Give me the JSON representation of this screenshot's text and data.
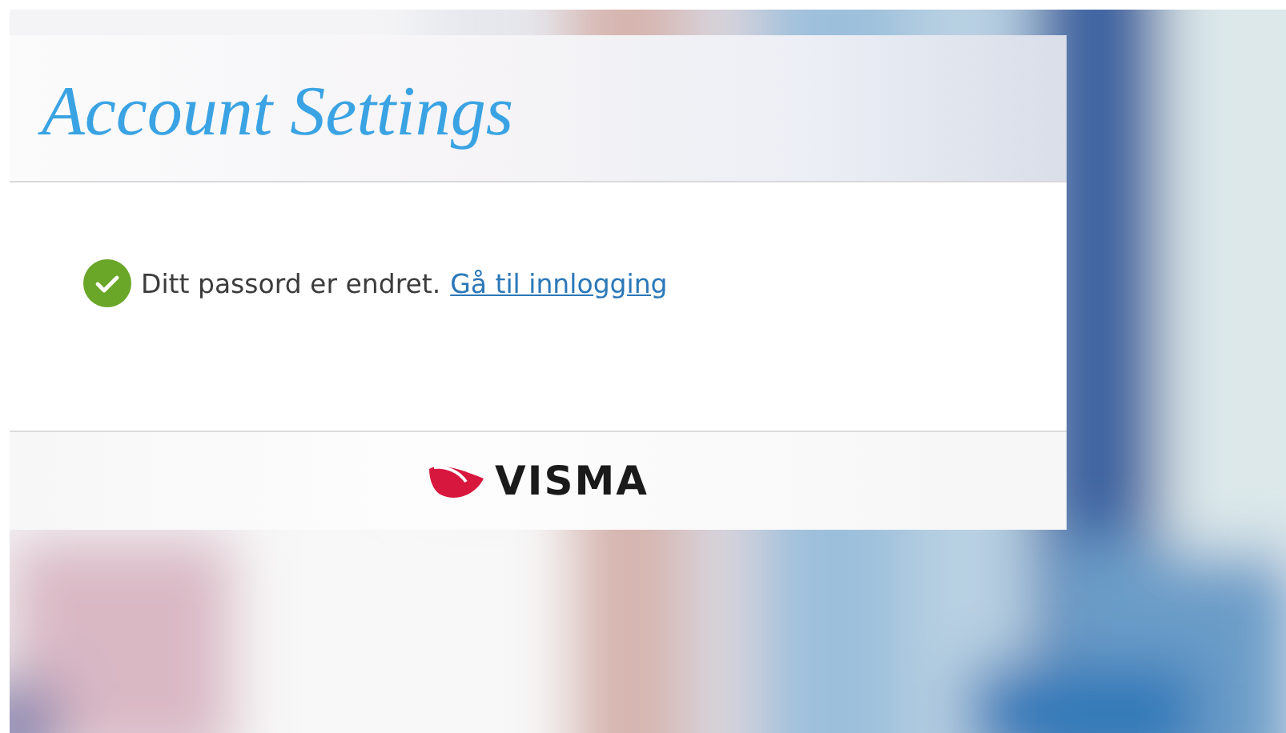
{
  "header": {
    "title": "Account Settings"
  },
  "message": {
    "kind": "success",
    "text": "Ditt passord er endret.",
    "link": "Gå til innlogging"
  },
  "footer": {
    "logo_text": "VISMA"
  }
}
